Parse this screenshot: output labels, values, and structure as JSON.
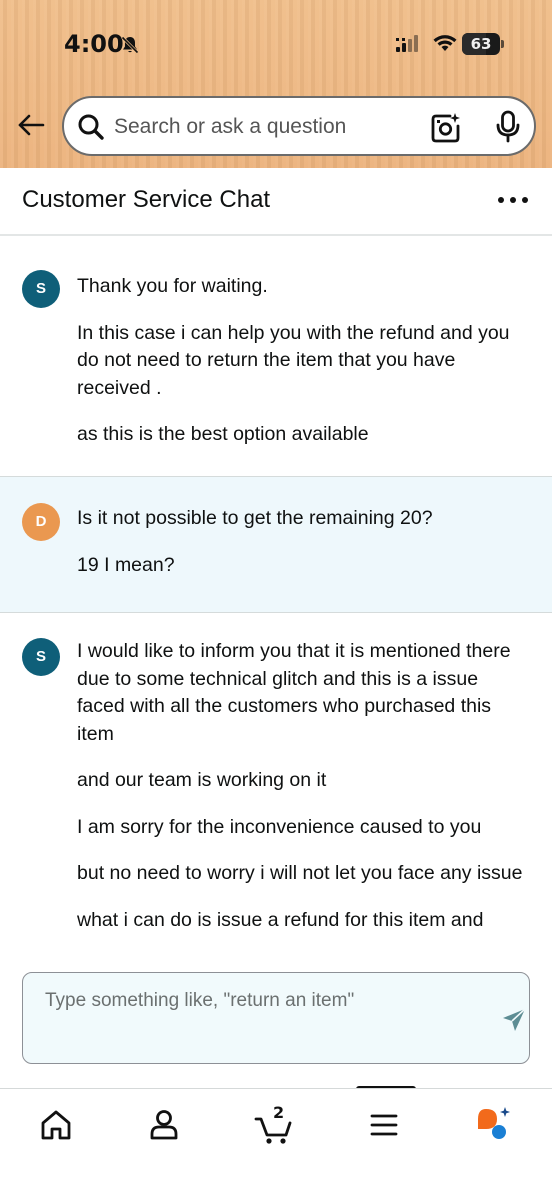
{
  "status_bar": {
    "time": "4:00",
    "battery": "63",
    "battery_level": 0.63
  },
  "search": {
    "placeholder": "Search or ask a question"
  },
  "chat_header": {
    "title": "Customer Service Chat"
  },
  "messages": [
    {
      "sender": "agent",
      "avatar": "S",
      "lines": [
        "Thank you for waiting.",
        "In this case i can help you with the refund and you do not need to return the item that you have received .",
        "as this is the best option available"
      ]
    },
    {
      "sender": "user",
      "avatar": "D",
      "lines": [
        "Is it not possible to get the remaining 20?",
        "19 I mean?"
      ]
    },
    {
      "sender": "agent",
      "avatar": "S",
      "lines": [
        "I would like to inform you that it is mentioned there due to some technical glitch and this is a issue faced with all the customers who purchased this item",
        "and our team is working on it",
        "I am sorry for the inconvenience caused to you",
        "but no need to worry i will not let you face any issue",
        "what i can do is issue a refund for this item and"
      ]
    }
  ],
  "composer": {
    "placeholder": "Type something like, \"return an item\""
  },
  "bottom_nav": {
    "cart_count": "2",
    "items": [
      "home-icon",
      "account-icon",
      "cart-icon",
      "menu-icon",
      "rufus-icon"
    ]
  },
  "colors": {
    "header_bg": "#ecb37d",
    "agent_avatar": "#0f5f79",
    "user_avatar": "#ea9850",
    "user_msg_bg": "#eef8fc",
    "send_icon": "#5d8d94",
    "rufus_orange": "#f26a1b",
    "rufus_blue": "#1a7fd4"
  }
}
